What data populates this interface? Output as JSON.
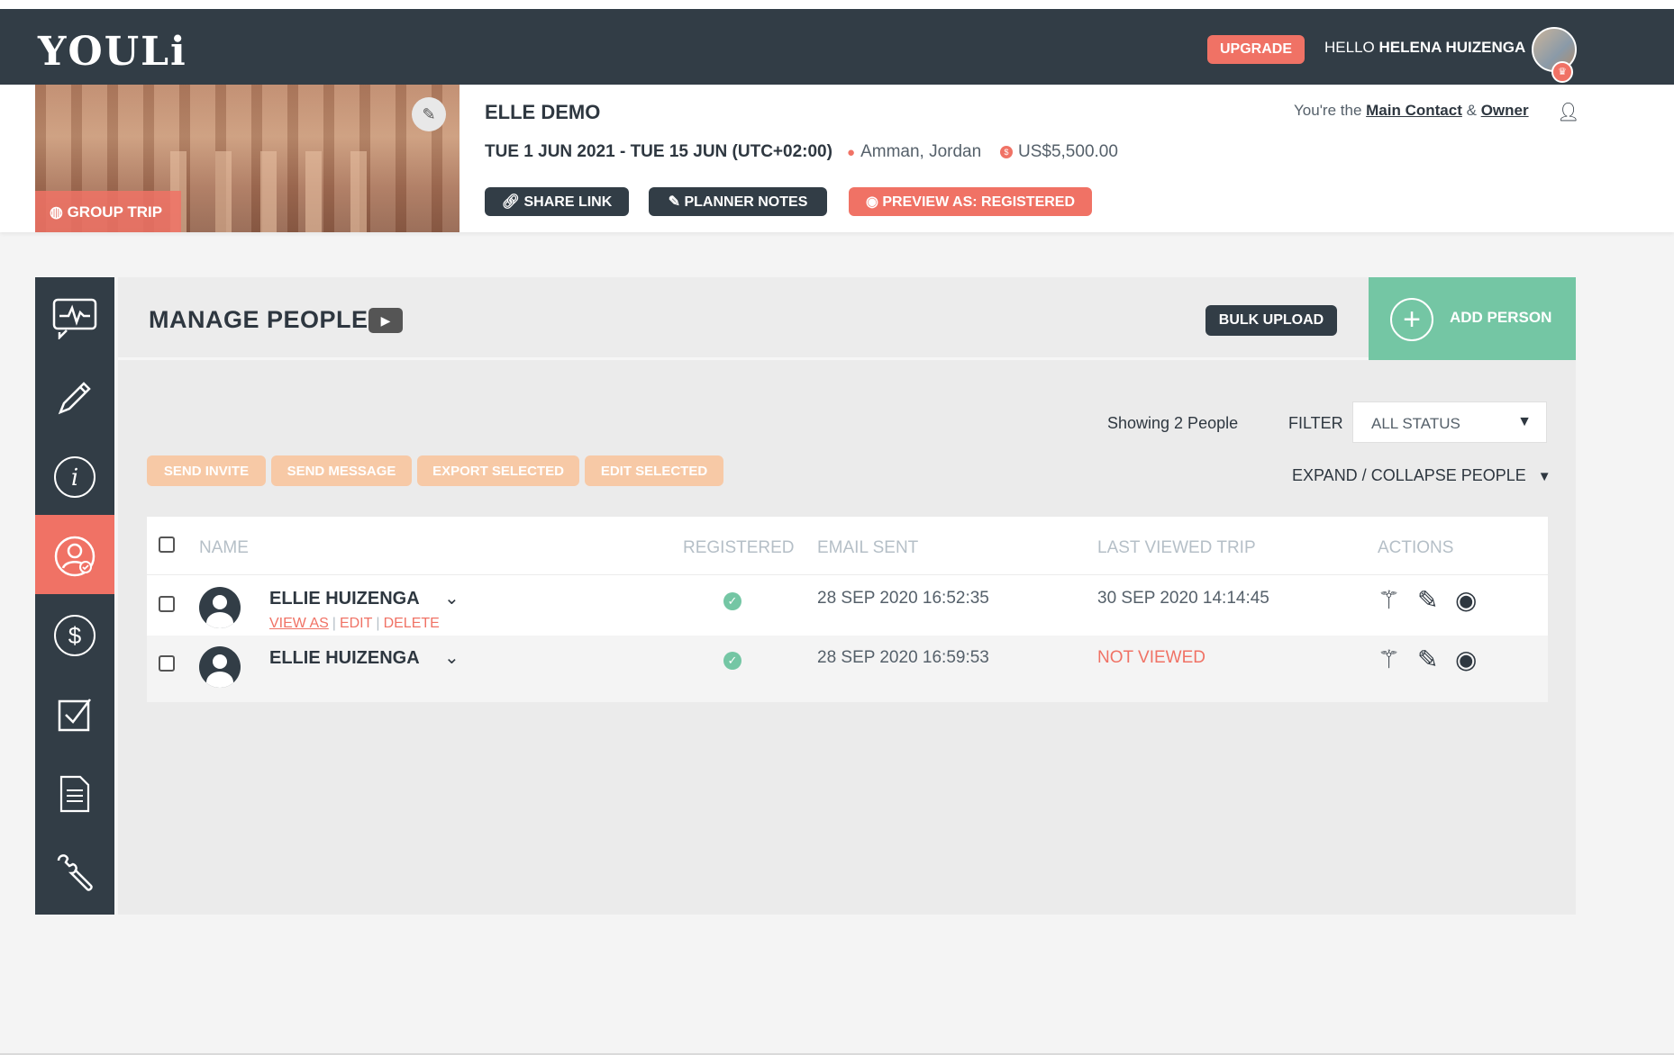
{
  "navbar": {
    "logo": "YOULi",
    "upgrade_label": "UPGRADE",
    "hello_prefix": "HELLO",
    "user_name": "HELENA HUIZENGA"
  },
  "trip": {
    "badge": "GROUP TRIP",
    "title": "ELLE DEMO",
    "dates": "TUE 1 JUN 2021 - TUE 15 JUN (UTC+02:00)",
    "location": "Amman, Jordan",
    "price": "US$5,500.00",
    "buttons": {
      "share": "SHARE LINK",
      "notes": "PLANNER NOTES",
      "preview": "PREVIEW AS: REGISTERED"
    },
    "contact": {
      "prefix": "You're the",
      "main_contact": "Main Contact",
      "amp": "&",
      "owner": "Owner"
    }
  },
  "sidebar": {
    "items": [
      {
        "icon": "chat-activity-icon"
      },
      {
        "icon": "pencil-icon"
      },
      {
        "icon": "info-icon",
        "glyph": "i"
      },
      {
        "icon": "people-icon",
        "active": true
      },
      {
        "icon": "dollar-icon",
        "glyph": "$"
      },
      {
        "icon": "checkbox-icon"
      },
      {
        "icon": "document-icon"
      },
      {
        "icon": "wrench-icon"
      }
    ]
  },
  "manage": {
    "title": "MANAGE PEOPLE",
    "bulk_upload": "BULK UPLOAD",
    "add_person": "ADD PERSON",
    "showing": "Showing 2 People",
    "filter_label": "FILTER",
    "filter_value": "ALL STATUS",
    "expand_collapse": "EXPAND / COLLAPSE PEOPLE",
    "actions": {
      "send_invite": "SEND INVITE",
      "send_message": "SEND MESSAGE",
      "export_selected": "EXPORT SELECTED",
      "edit_selected": "EDIT SELECTED"
    }
  },
  "table": {
    "headers": {
      "name": "NAME",
      "registered": "REGISTERED",
      "email_sent": "EMAIL SENT",
      "last_viewed": "LAST VIEWED TRIP",
      "actions": "ACTIONS"
    },
    "rows": [
      {
        "name": "ELLIE HUIZENGA",
        "registered": true,
        "email_sent": "28 SEP 2020 16:52:35",
        "last_viewed": "30 SEP 2020 14:14:45",
        "links": {
          "view_as": "VIEW AS",
          "edit": "EDIT",
          "delete": "DELETE",
          "sep": "|"
        }
      },
      {
        "name": "ELLIE HUIZENGA",
        "registered": true,
        "email_sent": "28 SEP 2020 16:59:53",
        "last_viewed": "NOT VIEWED"
      }
    ]
  },
  "colors": {
    "dark": "#323d46",
    "coral": "#f07265",
    "green": "#74c6a4",
    "peach": "#f7c9a6"
  }
}
